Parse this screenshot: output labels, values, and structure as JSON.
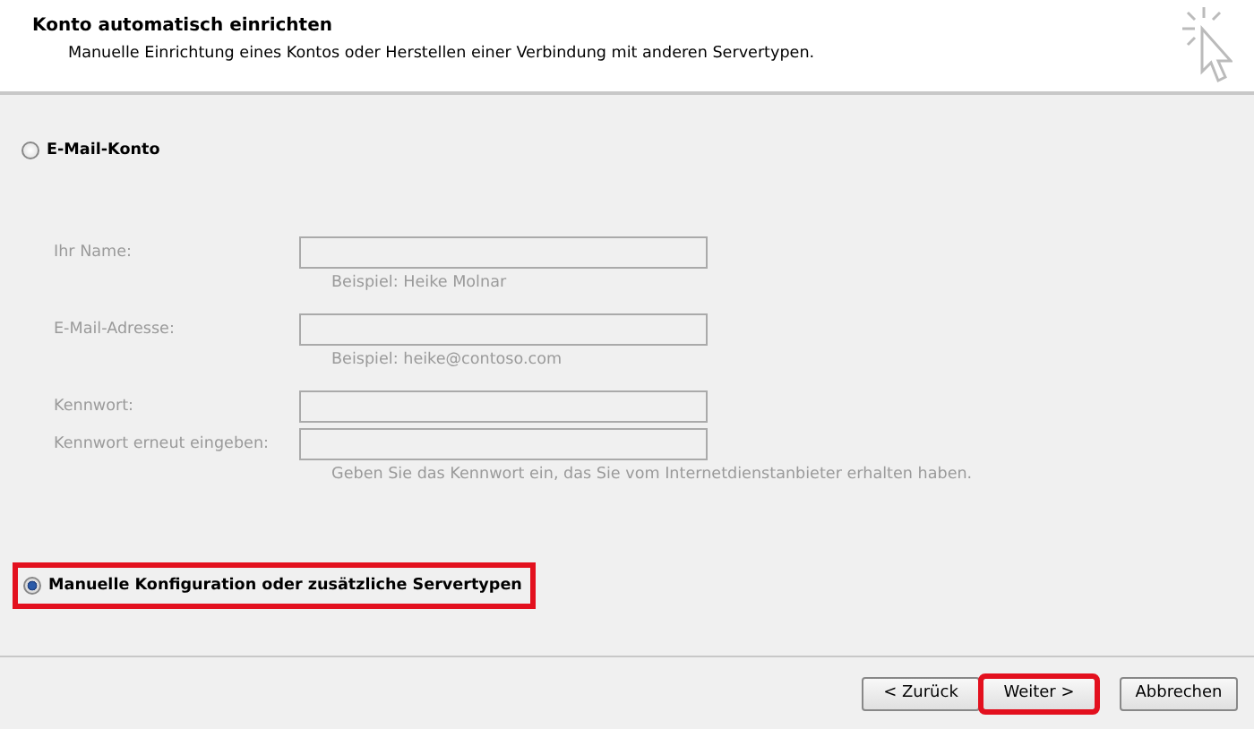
{
  "header": {
    "title": "Konto automatisch einrichten",
    "subtitle": "Manuelle Einrichtung eines Kontos oder Herstellen einer Verbindung mit anderen Servertypen."
  },
  "options": [
    {
      "label": "E-Mail-Konto",
      "selected": false,
      "highlighted": false
    },
    {
      "label": "Manuelle Konfiguration oder zusätzliche Servertypen",
      "selected": true,
      "highlighted": true
    }
  ],
  "fields": [
    {
      "label": "Ihr Name:",
      "disabled": true,
      "hint": "Beispiel: Heike Molnar"
    },
    {
      "label": "E-Mail-Adresse:",
      "disabled": true,
      "hint": "Beispiel: heike@contoso.com"
    },
    {
      "label": "Kennwort:",
      "disabled": true
    },
    {
      "label": "Kennwort erneut eingeben:",
      "disabled": true,
      "hint": "Geben Sie das Kennwort ein, das Sie vom Internetdienstanbieter erhalten haben."
    }
  ],
  "buttons": [
    {
      "label": "< Zurück",
      "highlighted": false
    },
    {
      "label": "Weiter >",
      "highlighted": true
    },
    {
      "label": "Abbrechen",
      "highlighted": false
    }
  ]
}
